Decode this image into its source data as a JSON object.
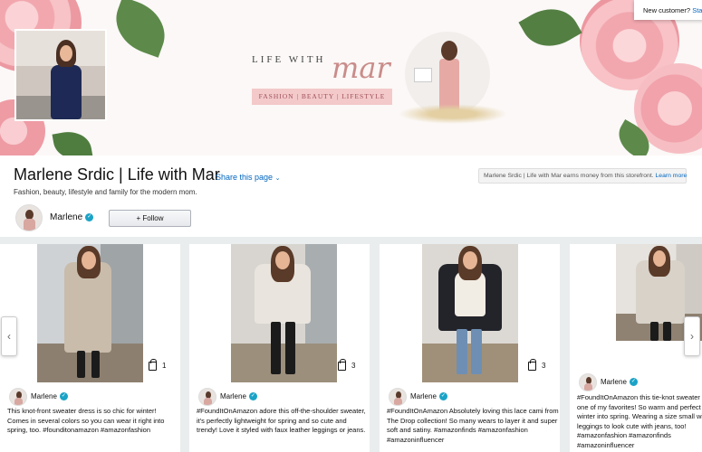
{
  "banner": {
    "logo_line1": "LIFE WITH",
    "logo_script": "mar",
    "logo_tagline": "FASHION | BEAUTY | LIFESTYLE",
    "new_customer_prompt": "New customer?",
    "new_customer_link": "Start"
  },
  "store": {
    "title": "Marlene Srdic | Life with Mar",
    "share_label": "Share this page",
    "description": "Fashion, beauty, lifestyle and family for the modern mom.",
    "earns_text": "Marlene Srdic | Life with Mar earns money from this storefront.",
    "learn_more": "Learn more",
    "user_name": "Marlene",
    "follow_label": "+ Follow"
  },
  "posts": [
    {
      "author": "Marlene",
      "product_count": "1",
      "caption": "This knot-front sweater dress is so chic for winter! Comes in several colors so you can wear it right into spring, too. #founditonamazon #amazonfashion"
    },
    {
      "author": "Marlene",
      "product_count": "3",
      "caption": "#FoundItOnAmazon adore this off-the-shoulder sweater, it's perfectly lightweight for spring and so cute and trendy! Love it styled with faux leather leggings or jeans."
    },
    {
      "author": "Marlene",
      "product_count": "3",
      "caption": "#FoundItOnAmazon Absolutely loving this lace cami from The Drop collection! So many wears to layer it and super soft and satiny. #amazonfinds #amazonfashion #amazoninfluencer"
    },
    {
      "author": "Marlene",
      "product_count": "",
      "caption": "#FoundItOnAmazon this tie-knot sweater is one of my favorites! So warm and perfect for winter into spring. Wearing a size small with leggings to look cute with jeans, too! #amazonfashion #amazonfinds #amazoninfluencer"
    }
  ],
  "colors": {
    "link": "#0066c0",
    "verified": "#1aa3c7",
    "feed_bg": "#eaeded",
    "logo_pink": "#c98c8a"
  },
  "icons": [
    "chevron-left-icon",
    "chevron-right-icon",
    "shopping-bag-icon",
    "verified-badge-icon",
    "chevron-down-icon"
  ]
}
